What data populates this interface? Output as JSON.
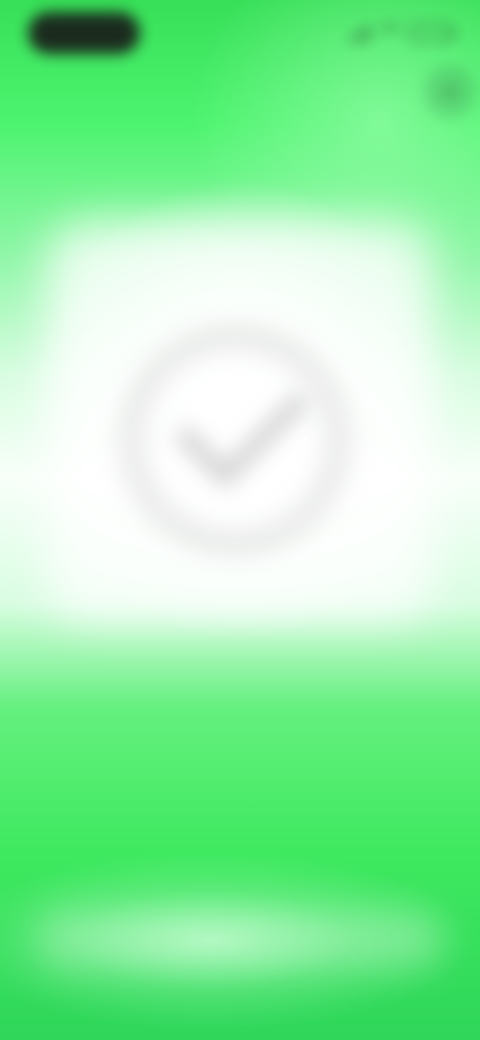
{
  "status_bar": {
    "time": "",
    "signal_icon": "signal-icon",
    "wifi_icon": "wifi-icon",
    "battery_icon": "battery-icon"
  },
  "header": {
    "close_icon": "close-icon",
    "title": ""
  },
  "main": {
    "icon": "check-circle-icon",
    "message": ""
  },
  "bottom": {
    "label": ""
  },
  "colors": {
    "accent_green": "#35dd59",
    "light_green": "#8cf6a5",
    "card_white": "#f8fff9",
    "blurred_gray": "#cdcdcd",
    "status_dark": "#181818"
  }
}
